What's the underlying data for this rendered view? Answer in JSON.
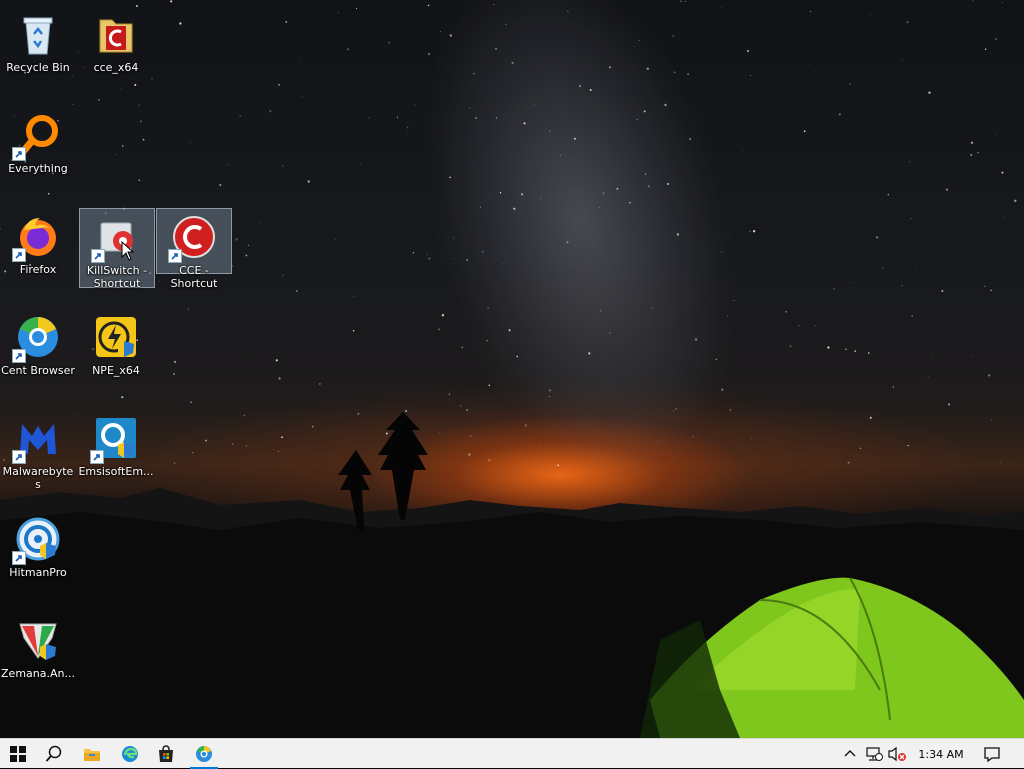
{
  "desktop": {
    "icons": {
      "recycle_bin": "Recycle Bin",
      "cce_x64": "cce_x64",
      "everything": "Everything",
      "firefox": "Firefox",
      "killswitch": "KillSwitch - Shortcut",
      "cce_shortcut": "CCE - Shortcut",
      "cent_browser": "Cent Browser",
      "npe_x64": "NPE_x64",
      "malwarebytes": "Malwarebytes",
      "emsisoft": "EmsisoftEm...",
      "hitmanpro": "HitmanPro",
      "zemana": "Zemana.An..."
    }
  },
  "taskbar": {
    "pinned": [
      "windows-start-icon",
      "search-icon",
      "file-explorer-icon",
      "edge-icon",
      "store-icon",
      "cent-browser-icon"
    ],
    "tray": {
      "clock": "1:34 AM",
      "icons": [
        "chevron-up-icon",
        "network-icon",
        "volume-muted-icon",
        "notification-icon"
      ]
    }
  },
  "colors": {
    "taskbar_bg": "#f1f1f1",
    "accent": "#0078d7",
    "selection": "#9aabbe"
  }
}
